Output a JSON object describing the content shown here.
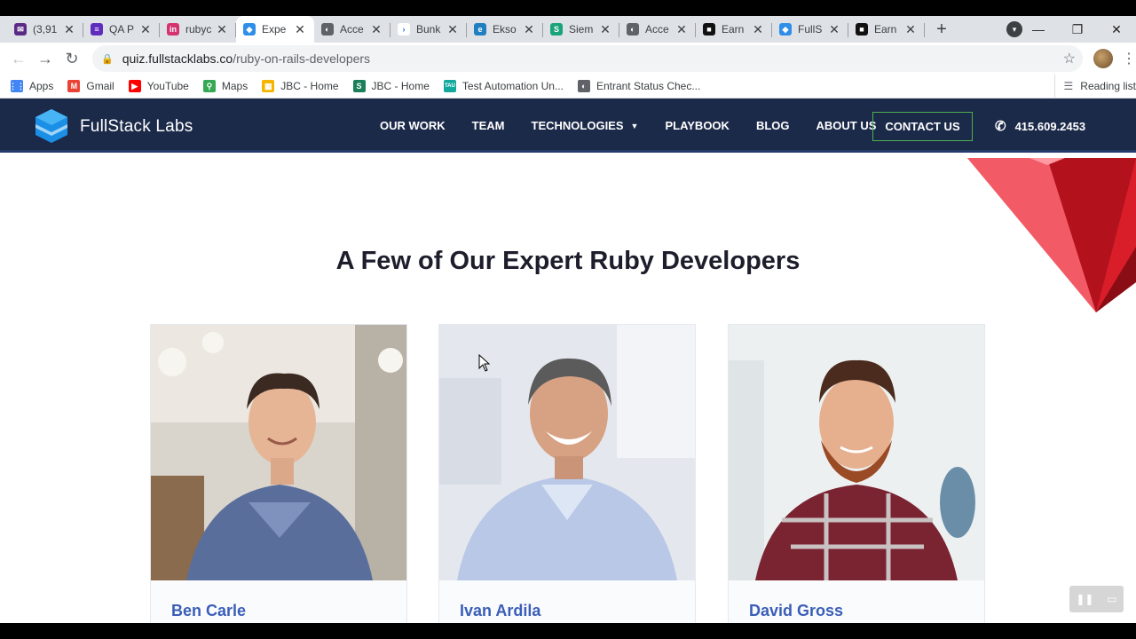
{
  "browser": {
    "tabs": [
      {
        "title": "(3,91",
        "favicon_color": "#5b2a86",
        "favicon_glyph": "✉"
      },
      {
        "title": "QA P",
        "favicon_color": "#5f2dbd",
        "favicon_glyph": "≡"
      },
      {
        "title": "rubyc",
        "favicon_color": "#d4336f",
        "favicon_glyph": "in"
      },
      {
        "title": "Expe",
        "favicon_color": "#2f8fe8",
        "favicon_glyph": "◆",
        "active": true
      },
      {
        "title": "Acce",
        "favicon_color": "#5f6368",
        "favicon_glyph": "◐"
      },
      {
        "title": "Bunk",
        "favicon_color": "#ffffff",
        "favicon_glyph": "›"
      },
      {
        "title": "Ekso",
        "favicon_color": "#1f7fc1",
        "favicon_glyph": "e"
      },
      {
        "title": "Siem",
        "favicon_color": "#1aa37a",
        "favicon_glyph": "S"
      },
      {
        "title": "Acce",
        "favicon_color": "#5f6368",
        "favicon_glyph": "◐"
      },
      {
        "title": "Earn",
        "favicon_color": "#111111",
        "favicon_glyph": "■"
      },
      {
        "title": "FullS",
        "favicon_color": "#2f8fe8",
        "favicon_glyph": "◆"
      },
      {
        "title": "Earn",
        "favicon_color": "#111111",
        "favicon_glyph": "■"
      }
    ],
    "tab_close_glyph": "✕",
    "new_tab_glyph": "+",
    "tab_search_glyph": "▾",
    "window_controls": {
      "minimize": "—",
      "restore": "❐",
      "close": "✕"
    },
    "nav": {
      "back": "←",
      "forward": "→",
      "reload": "↻"
    },
    "url": {
      "host": "quiz.fullstacklabs.co",
      "path": "/ruby-on-rails-developers",
      "lock": "🔒",
      "star": "☆"
    },
    "menu_glyph": "⋮",
    "bookmarks": [
      {
        "label": "Apps",
        "icon_color": "#4285f4",
        "glyph": "⋮⋮"
      },
      {
        "label": "Gmail",
        "icon_color": "#ea4335",
        "glyph": "M"
      },
      {
        "label": "YouTube",
        "icon_color": "#ff0000",
        "glyph": "▶"
      },
      {
        "label": "Maps",
        "icon_color": "#34a853",
        "glyph": "⚲"
      },
      {
        "label": "JBC - Home",
        "icon_color": "#f4b400",
        "glyph": "▦"
      },
      {
        "label": "JBC - Home",
        "icon_color": "#1a7f5a",
        "glyph": "S"
      },
      {
        "label": "Test Automation Un...",
        "icon_color": "#13a89e",
        "glyph": "TAU"
      },
      {
        "label": "Entrant Status Chec...",
        "icon_color": "#5f6368",
        "glyph": "◐"
      }
    ],
    "reading_list": {
      "label": "Reading list",
      "glyph": "☰"
    }
  },
  "site": {
    "brand": "FullStack Labs",
    "nav": [
      "OUR WORK",
      "TEAM",
      "TECHNOLOGIES",
      "PLAYBOOK",
      "BLOG",
      "ABOUT US"
    ],
    "dropdown_caret": "▼",
    "contact": "CONTACT US",
    "phone": "415.609.2453",
    "phone_glyph": "✆",
    "colors": {
      "header": "#1c2a4a",
      "contact_border": "#4caf50",
      "name_blue": "#3a5eb7"
    }
  },
  "main": {
    "title": "A Few of Our Expert Ruby Developers",
    "developers": [
      {
        "name": "Ben Carle"
      },
      {
        "name": "Ivan Ardila"
      },
      {
        "name": "David Gross"
      }
    ]
  },
  "video_controls": {
    "pause": "❚❚",
    "pip": "▭"
  }
}
